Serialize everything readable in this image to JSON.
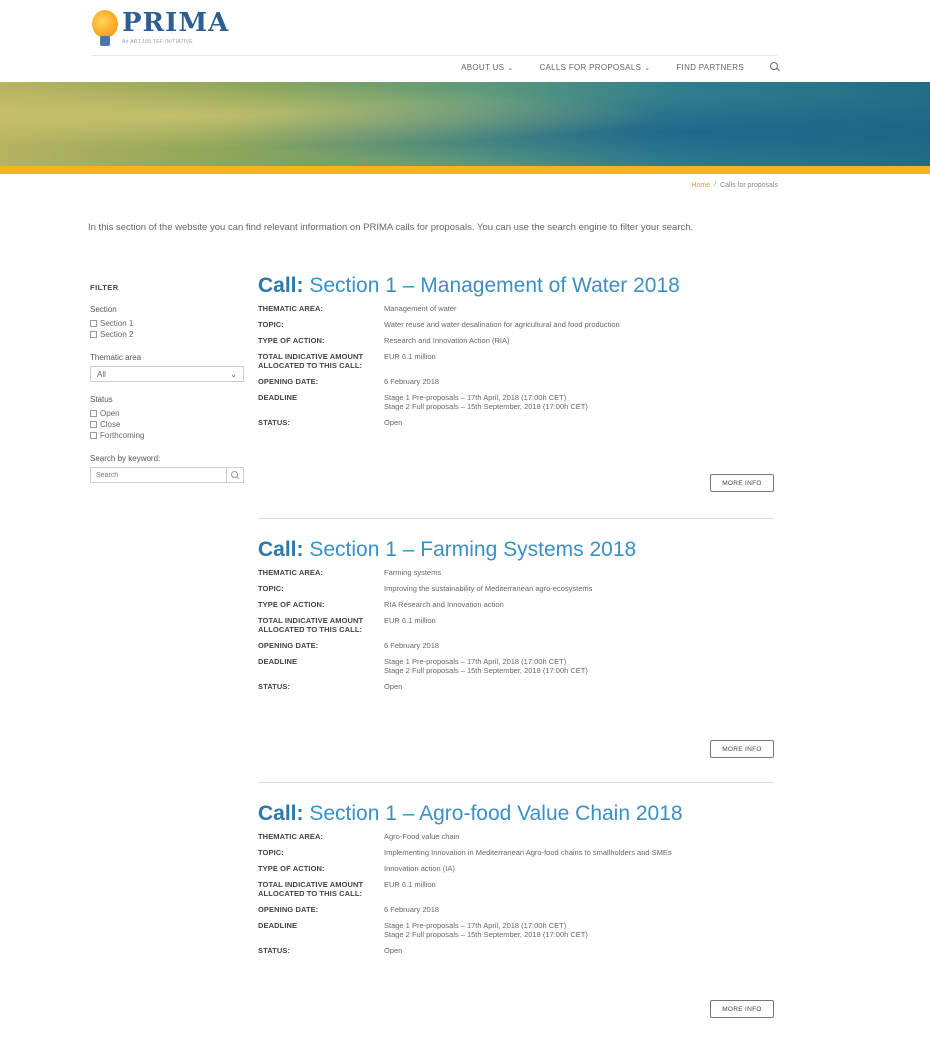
{
  "brand": {
    "name": "PRIMA",
    "tagline": "An ART.185 TEF INITIATIVE"
  },
  "nav": {
    "items": [
      {
        "label": "ABOUT US",
        "dropdown": true
      },
      {
        "label": "CALLS FOR PROPOSALS",
        "dropdown": true
      },
      {
        "label": "FIND PARTNERS",
        "dropdown": false
      }
    ],
    "chevron": "⌄"
  },
  "breadcrumb": {
    "home": "Home",
    "separator": "/",
    "current": "Calls for proposals"
  },
  "intro": "In this section of the website you can find relevant information on PRIMA calls for proposals. You can use the search engine to filter your search.",
  "filter": {
    "title": "FILTER",
    "section_label": "Section",
    "sections": [
      "Section 1",
      "Section 2"
    ],
    "thematic_label": "Thematic area",
    "thematic_value": "All",
    "status_label": "Status",
    "statuses": [
      "Open",
      "Close",
      "Forthcoming"
    ],
    "keyword_label": "Search by keyword:",
    "keyword_placeholder": "Search"
  },
  "labels": {
    "thematic": "THEMATIC AREA:",
    "topic": "TOPIC:",
    "type": "TYPE OF ACTION:",
    "amount": "TOTAL INDICATIVE AMOUNT ALLOCATED TO THIS CALL:",
    "opening": "OPENING DATE:",
    "deadline": "DEADLINE",
    "status": "STATUS:",
    "more": "MORE INFO"
  },
  "calls": [
    {
      "prefix": "Call:",
      "title": "Section 1 – Management of Water 2018",
      "thematic": "Management of water",
      "topic": "Water reuse and water desalination for agricultural and food production",
      "type": "Research and Innovation Action (RIA)",
      "amount": "EUR 6.1 million",
      "opening": "6 February 2018",
      "deadline1": "Stage 1 Pre-proposals – 17th April, 2018 (17:00h CET)",
      "deadline2": "Stage 2 Full proposals – 15th September, 2018 (17:00h CET)",
      "status": "Open"
    },
    {
      "prefix": "Call:",
      "title": "Section 1 – Farming Systems 2018",
      "thematic": "Farming systems",
      "topic": "Improving the sustainability of Mediterranean agro-ecosystems",
      "type": "RIA Research and Innovation action",
      "amount": "EUR 6.1 million",
      "opening": "6 February 2018",
      "deadline1": "Stage 1 Pre-proposals – 17th April, 2018 (17:00h CET)",
      "deadline2": "Stage 2 Full proposals – 15th September, 2018 (17:00h CET)",
      "status": "Open"
    },
    {
      "prefix": "Call:",
      "title": "Section 1 – Agro-food Value Chain 2018",
      "thematic": "Agro-Food value chain",
      "topic": "Implementing Innovation in Mediterranean Agro-food chains to smallholders and SMEs",
      "type": "Innovation action (IA)",
      "amount": "EUR 6.1 million",
      "opening": "6 February 2018",
      "deadline1": "Stage 1 Pre-proposals – 17th April, 2018 (17:00h CET)",
      "deadline2": "Stage 2 Full proposals – 15th September, 2018 (17:00h CET)",
      "status": "Open"
    }
  ]
}
